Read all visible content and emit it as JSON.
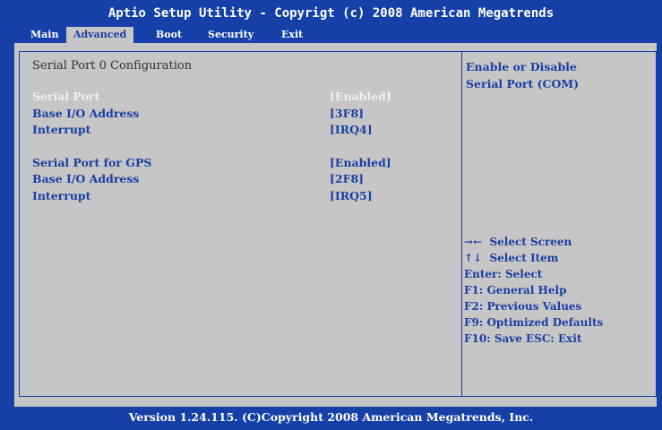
{
  "title": "Aptio Setup Utility - Copyrigt (c) 2008 American Megatrends",
  "tabs": [
    {
      "label": "Main",
      "active": false
    },
    {
      "label": "Advanced",
      "active": true
    },
    {
      "label": "Boot",
      "active": false
    },
    {
      "label": "Security",
      "active": false
    },
    {
      "label": "Exit",
      "active": false
    }
  ],
  "section_title": "Serial Port 0 Configuration",
  "settings": [
    {
      "label": "Serial Port",
      "value": "[Enabled]",
      "selected": true
    },
    {
      "label": "Base I/O Address",
      "value": "[3F8]"
    },
    {
      "label": "Interrupt",
      "value": "[IRQ4]"
    },
    {
      "label": "Serial Port for GPS",
      "value": "[Enabled]"
    },
    {
      "label": "Base I/O Address",
      "value": "[2F8]"
    },
    {
      "label": "Interrupt",
      "value": "[IRQ5]"
    }
  ],
  "help": {
    "line1": "Enable or Disable",
    "line2": "Serial Port (COM)"
  },
  "keys": [
    "→←  Select Screen",
    "↑↓  Select Item",
    "Enter: Select",
    "F1: General Help",
    "F2: Previous Values",
    "F9: Optimized Defaults",
    "F10: Save ESC: Exit"
  ],
  "footer": "Version 1.24.115. (C)Copyright 2008 American Megatrends, Inc.",
  "colors": {
    "blue": "#1440a8",
    "gray": "#c6c6c6",
    "text_blue": "#1a3fa3",
    "highlight": "#f0f0f0"
  }
}
